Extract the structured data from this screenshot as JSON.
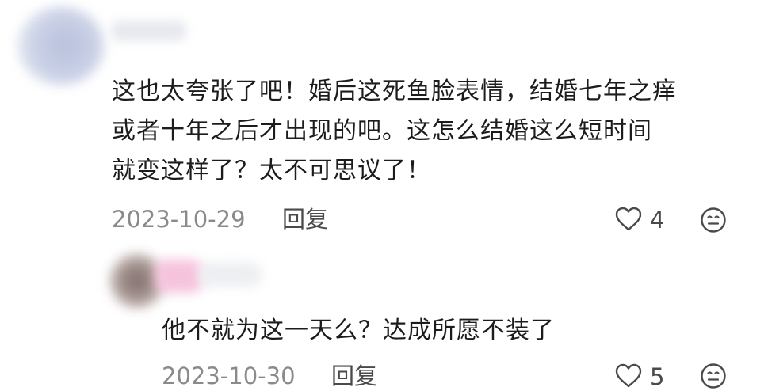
{
  "comments": [
    {
      "text_lines": [
        "这也太夸张了吧！婚后这死鱼脸表情，结婚七年之痒",
        "或者十年之后才出现的吧。这怎么结婚这么短时间",
        "就变这样了？太不可思议了！"
      ],
      "date": "2023-10-29",
      "reply_label": "回复",
      "like_count": "4"
    },
    {
      "text_lines": [
        "他不就为这一天么？达成所愿不装了"
      ],
      "date": "2023-10-30",
      "reply_label": "回复",
      "like_count": "5"
    }
  ],
  "icons": {
    "like": "heart-outline-icon",
    "emoji": "neutral-face-icon"
  },
  "colors": {
    "text": "#1c1c1c",
    "meta_text": "#8a8a8a",
    "icon": "#4a4a4a"
  }
}
